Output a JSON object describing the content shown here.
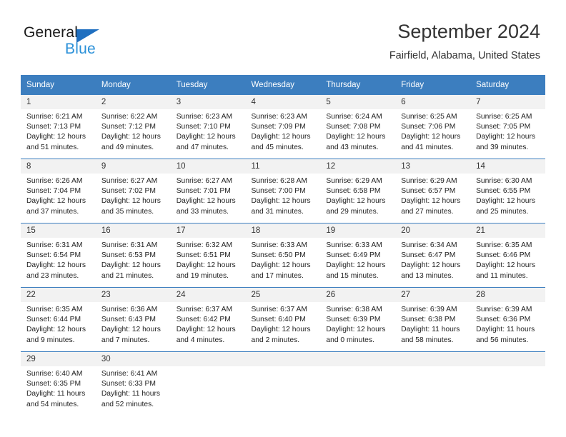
{
  "brand": {
    "name_top": "General",
    "name_bottom": "Blue",
    "triangle_color": "#1f6fc0",
    "blue_color": "#2a90d8"
  },
  "header": {
    "title": "September 2024",
    "subtitle": "Fairfield, Alabama, United States"
  },
  "colors": {
    "header_bar": "#3c7ebf",
    "daynum_band": "#f2f2f2",
    "week_divider": "#3c7ebf"
  },
  "weekday_headers": [
    "Sunday",
    "Monday",
    "Tuesday",
    "Wednesday",
    "Thursday",
    "Friday",
    "Saturday"
  ],
  "weeks": [
    [
      {
        "day": "1",
        "sunrise": "Sunrise: 6:21 AM",
        "sunset": "Sunset: 7:13 PM",
        "daylight_line1": "Daylight: 12 hours",
        "daylight_line2": "and 51 minutes."
      },
      {
        "day": "2",
        "sunrise": "Sunrise: 6:22 AM",
        "sunset": "Sunset: 7:12 PM",
        "daylight_line1": "Daylight: 12 hours",
        "daylight_line2": "and 49 minutes."
      },
      {
        "day": "3",
        "sunrise": "Sunrise: 6:23 AM",
        "sunset": "Sunset: 7:10 PM",
        "daylight_line1": "Daylight: 12 hours",
        "daylight_line2": "and 47 minutes."
      },
      {
        "day": "4",
        "sunrise": "Sunrise: 6:23 AM",
        "sunset": "Sunset: 7:09 PM",
        "daylight_line1": "Daylight: 12 hours",
        "daylight_line2": "and 45 minutes."
      },
      {
        "day": "5",
        "sunrise": "Sunrise: 6:24 AM",
        "sunset": "Sunset: 7:08 PM",
        "daylight_line1": "Daylight: 12 hours",
        "daylight_line2": "and 43 minutes."
      },
      {
        "day": "6",
        "sunrise": "Sunrise: 6:25 AM",
        "sunset": "Sunset: 7:06 PM",
        "daylight_line1": "Daylight: 12 hours",
        "daylight_line2": "and 41 minutes."
      },
      {
        "day": "7",
        "sunrise": "Sunrise: 6:25 AM",
        "sunset": "Sunset: 7:05 PM",
        "daylight_line1": "Daylight: 12 hours",
        "daylight_line2": "and 39 minutes."
      }
    ],
    [
      {
        "day": "8",
        "sunrise": "Sunrise: 6:26 AM",
        "sunset": "Sunset: 7:04 PM",
        "daylight_line1": "Daylight: 12 hours",
        "daylight_line2": "and 37 minutes."
      },
      {
        "day": "9",
        "sunrise": "Sunrise: 6:27 AM",
        "sunset": "Sunset: 7:02 PM",
        "daylight_line1": "Daylight: 12 hours",
        "daylight_line2": "and 35 minutes."
      },
      {
        "day": "10",
        "sunrise": "Sunrise: 6:27 AM",
        "sunset": "Sunset: 7:01 PM",
        "daylight_line1": "Daylight: 12 hours",
        "daylight_line2": "and 33 minutes."
      },
      {
        "day": "11",
        "sunrise": "Sunrise: 6:28 AM",
        "sunset": "Sunset: 7:00 PM",
        "daylight_line1": "Daylight: 12 hours",
        "daylight_line2": "and 31 minutes."
      },
      {
        "day": "12",
        "sunrise": "Sunrise: 6:29 AM",
        "sunset": "Sunset: 6:58 PM",
        "daylight_line1": "Daylight: 12 hours",
        "daylight_line2": "and 29 minutes."
      },
      {
        "day": "13",
        "sunrise": "Sunrise: 6:29 AM",
        "sunset": "Sunset: 6:57 PM",
        "daylight_line1": "Daylight: 12 hours",
        "daylight_line2": "and 27 minutes."
      },
      {
        "day": "14",
        "sunrise": "Sunrise: 6:30 AM",
        "sunset": "Sunset: 6:55 PM",
        "daylight_line1": "Daylight: 12 hours",
        "daylight_line2": "and 25 minutes."
      }
    ],
    [
      {
        "day": "15",
        "sunrise": "Sunrise: 6:31 AM",
        "sunset": "Sunset: 6:54 PM",
        "daylight_line1": "Daylight: 12 hours",
        "daylight_line2": "and 23 minutes."
      },
      {
        "day": "16",
        "sunrise": "Sunrise: 6:31 AM",
        "sunset": "Sunset: 6:53 PM",
        "daylight_line1": "Daylight: 12 hours",
        "daylight_line2": "and 21 minutes."
      },
      {
        "day": "17",
        "sunrise": "Sunrise: 6:32 AM",
        "sunset": "Sunset: 6:51 PM",
        "daylight_line1": "Daylight: 12 hours",
        "daylight_line2": "and 19 minutes."
      },
      {
        "day": "18",
        "sunrise": "Sunrise: 6:33 AM",
        "sunset": "Sunset: 6:50 PM",
        "daylight_line1": "Daylight: 12 hours",
        "daylight_line2": "and 17 minutes."
      },
      {
        "day": "19",
        "sunrise": "Sunrise: 6:33 AM",
        "sunset": "Sunset: 6:49 PM",
        "daylight_line1": "Daylight: 12 hours",
        "daylight_line2": "and 15 minutes."
      },
      {
        "day": "20",
        "sunrise": "Sunrise: 6:34 AM",
        "sunset": "Sunset: 6:47 PM",
        "daylight_line1": "Daylight: 12 hours",
        "daylight_line2": "and 13 minutes."
      },
      {
        "day": "21",
        "sunrise": "Sunrise: 6:35 AM",
        "sunset": "Sunset: 6:46 PM",
        "daylight_line1": "Daylight: 12 hours",
        "daylight_line2": "and 11 minutes."
      }
    ],
    [
      {
        "day": "22",
        "sunrise": "Sunrise: 6:35 AM",
        "sunset": "Sunset: 6:44 PM",
        "daylight_line1": "Daylight: 12 hours",
        "daylight_line2": "and 9 minutes."
      },
      {
        "day": "23",
        "sunrise": "Sunrise: 6:36 AM",
        "sunset": "Sunset: 6:43 PM",
        "daylight_line1": "Daylight: 12 hours",
        "daylight_line2": "and 7 minutes."
      },
      {
        "day": "24",
        "sunrise": "Sunrise: 6:37 AM",
        "sunset": "Sunset: 6:42 PM",
        "daylight_line1": "Daylight: 12 hours",
        "daylight_line2": "and 4 minutes."
      },
      {
        "day": "25",
        "sunrise": "Sunrise: 6:37 AM",
        "sunset": "Sunset: 6:40 PM",
        "daylight_line1": "Daylight: 12 hours",
        "daylight_line2": "and 2 minutes."
      },
      {
        "day": "26",
        "sunrise": "Sunrise: 6:38 AM",
        "sunset": "Sunset: 6:39 PM",
        "daylight_line1": "Daylight: 12 hours",
        "daylight_line2": "and 0 minutes."
      },
      {
        "day": "27",
        "sunrise": "Sunrise: 6:39 AM",
        "sunset": "Sunset: 6:38 PM",
        "daylight_line1": "Daylight: 11 hours",
        "daylight_line2": "and 58 minutes."
      },
      {
        "day": "28",
        "sunrise": "Sunrise: 6:39 AM",
        "sunset": "Sunset: 6:36 PM",
        "daylight_line1": "Daylight: 11 hours",
        "daylight_line2": "and 56 minutes."
      }
    ],
    [
      {
        "day": "29",
        "sunrise": "Sunrise: 6:40 AM",
        "sunset": "Sunset: 6:35 PM",
        "daylight_line1": "Daylight: 11 hours",
        "daylight_line2": "and 54 minutes."
      },
      {
        "day": "30",
        "sunrise": "Sunrise: 6:41 AM",
        "sunset": "Sunset: 6:33 PM",
        "daylight_line1": "Daylight: 11 hours",
        "daylight_line2": "and 52 minutes."
      },
      {
        "day": "",
        "sunrise": "",
        "sunset": "",
        "daylight_line1": "",
        "daylight_line2": ""
      },
      {
        "day": "",
        "sunrise": "",
        "sunset": "",
        "daylight_line1": "",
        "daylight_line2": ""
      },
      {
        "day": "",
        "sunrise": "",
        "sunset": "",
        "daylight_line1": "",
        "daylight_line2": ""
      },
      {
        "day": "",
        "sunrise": "",
        "sunset": "",
        "daylight_line1": "",
        "daylight_line2": ""
      },
      {
        "day": "",
        "sunrise": "",
        "sunset": "",
        "daylight_line1": "",
        "daylight_line2": ""
      }
    ]
  ]
}
